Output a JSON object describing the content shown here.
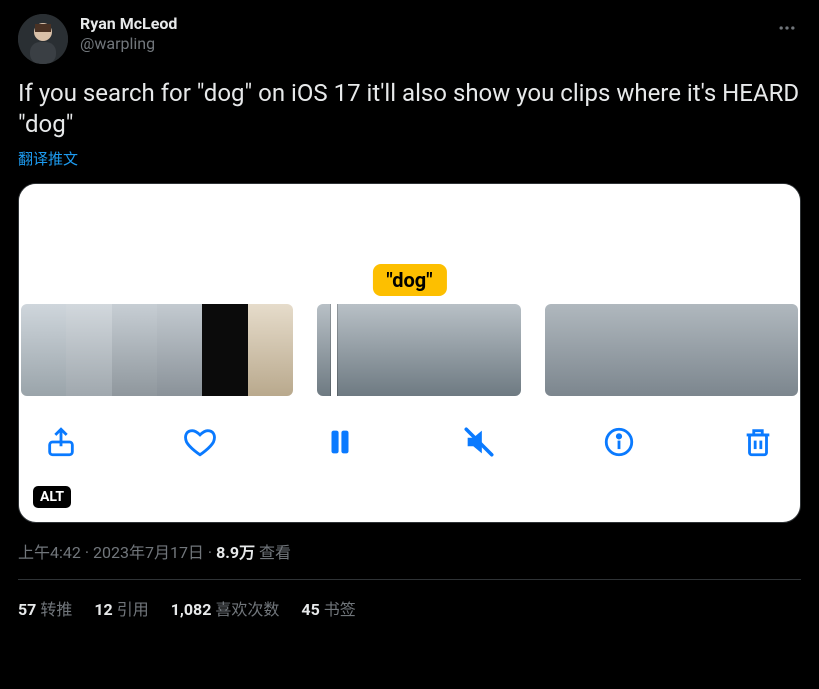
{
  "author": {
    "display_name": "Ryan McLeod",
    "handle": "@warpling"
  },
  "tweet_text": "If you search for \"dog\" on iOS 17 it'll also show you clips where it's HEARD \"dog\"",
  "translate_label": "翻译推文",
  "media": {
    "search_tag": "\"dog\"",
    "alt_badge": "ALT",
    "controls": {
      "share": "share-icon",
      "like": "heart-icon",
      "play_pause": "pause-icon",
      "mute": "mute-icon",
      "info": "info-icon",
      "delete": "trash-icon"
    }
  },
  "meta": {
    "time": "上午4:42",
    "sep1": " · ",
    "date": "2023年7月17日",
    "sep2": " · ",
    "views_num": "8.9万",
    "views_label": " 查看"
  },
  "stats": {
    "retweets_num": "57",
    "retweets_label": "转推",
    "quotes_num": "12",
    "quotes_label": "引用",
    "likes_num": "1,082",
    "likes_label": "喜欢次数",
    "bookmarks_num": "45",
    "bookmarks_label": "书签"
  }
}
